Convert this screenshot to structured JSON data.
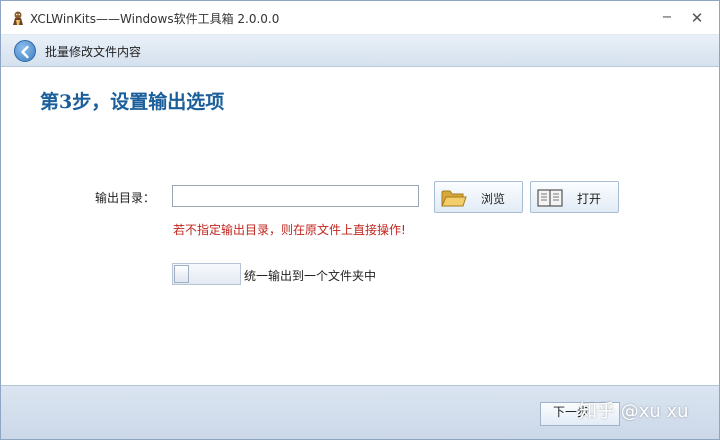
{
  "window": {
    "title": "XCLWinKits——Windows软件工具箱 2.0.0.0",
    "minimize_glyph": "−",
    "close_glyph": "✕"
  },
  "nav": {
    "title": "批量修改文件内容",
    "back_icon": "back-arrow-icon"
  },
  "step": {
    "title": "第3步，设置输出选项"
  },
  "form": {
    "output_dir_label": "输出目录：",
    "output_dir_value": "",
    "browse_label": "浏览",
    "browse_icon": "folder-icon",
    "open_label": "打开",
    "open_icon": "book-icon",
    "warning": "若不指定输出目录，则在原文件上直接操作!",
    "unify_toggle_label": "统一输出到一个文件夹中",
    "unify_toggle_on": false
  },
  "footer": {
    "next_label": "下一步"
  },
  "watermark": "知乎 @xu xu",
  "colors": {
    "accent": "#1a5e9a",
    "warning": "#c0261e",
    "nav_bg": "#dde7f2"
  }
}
